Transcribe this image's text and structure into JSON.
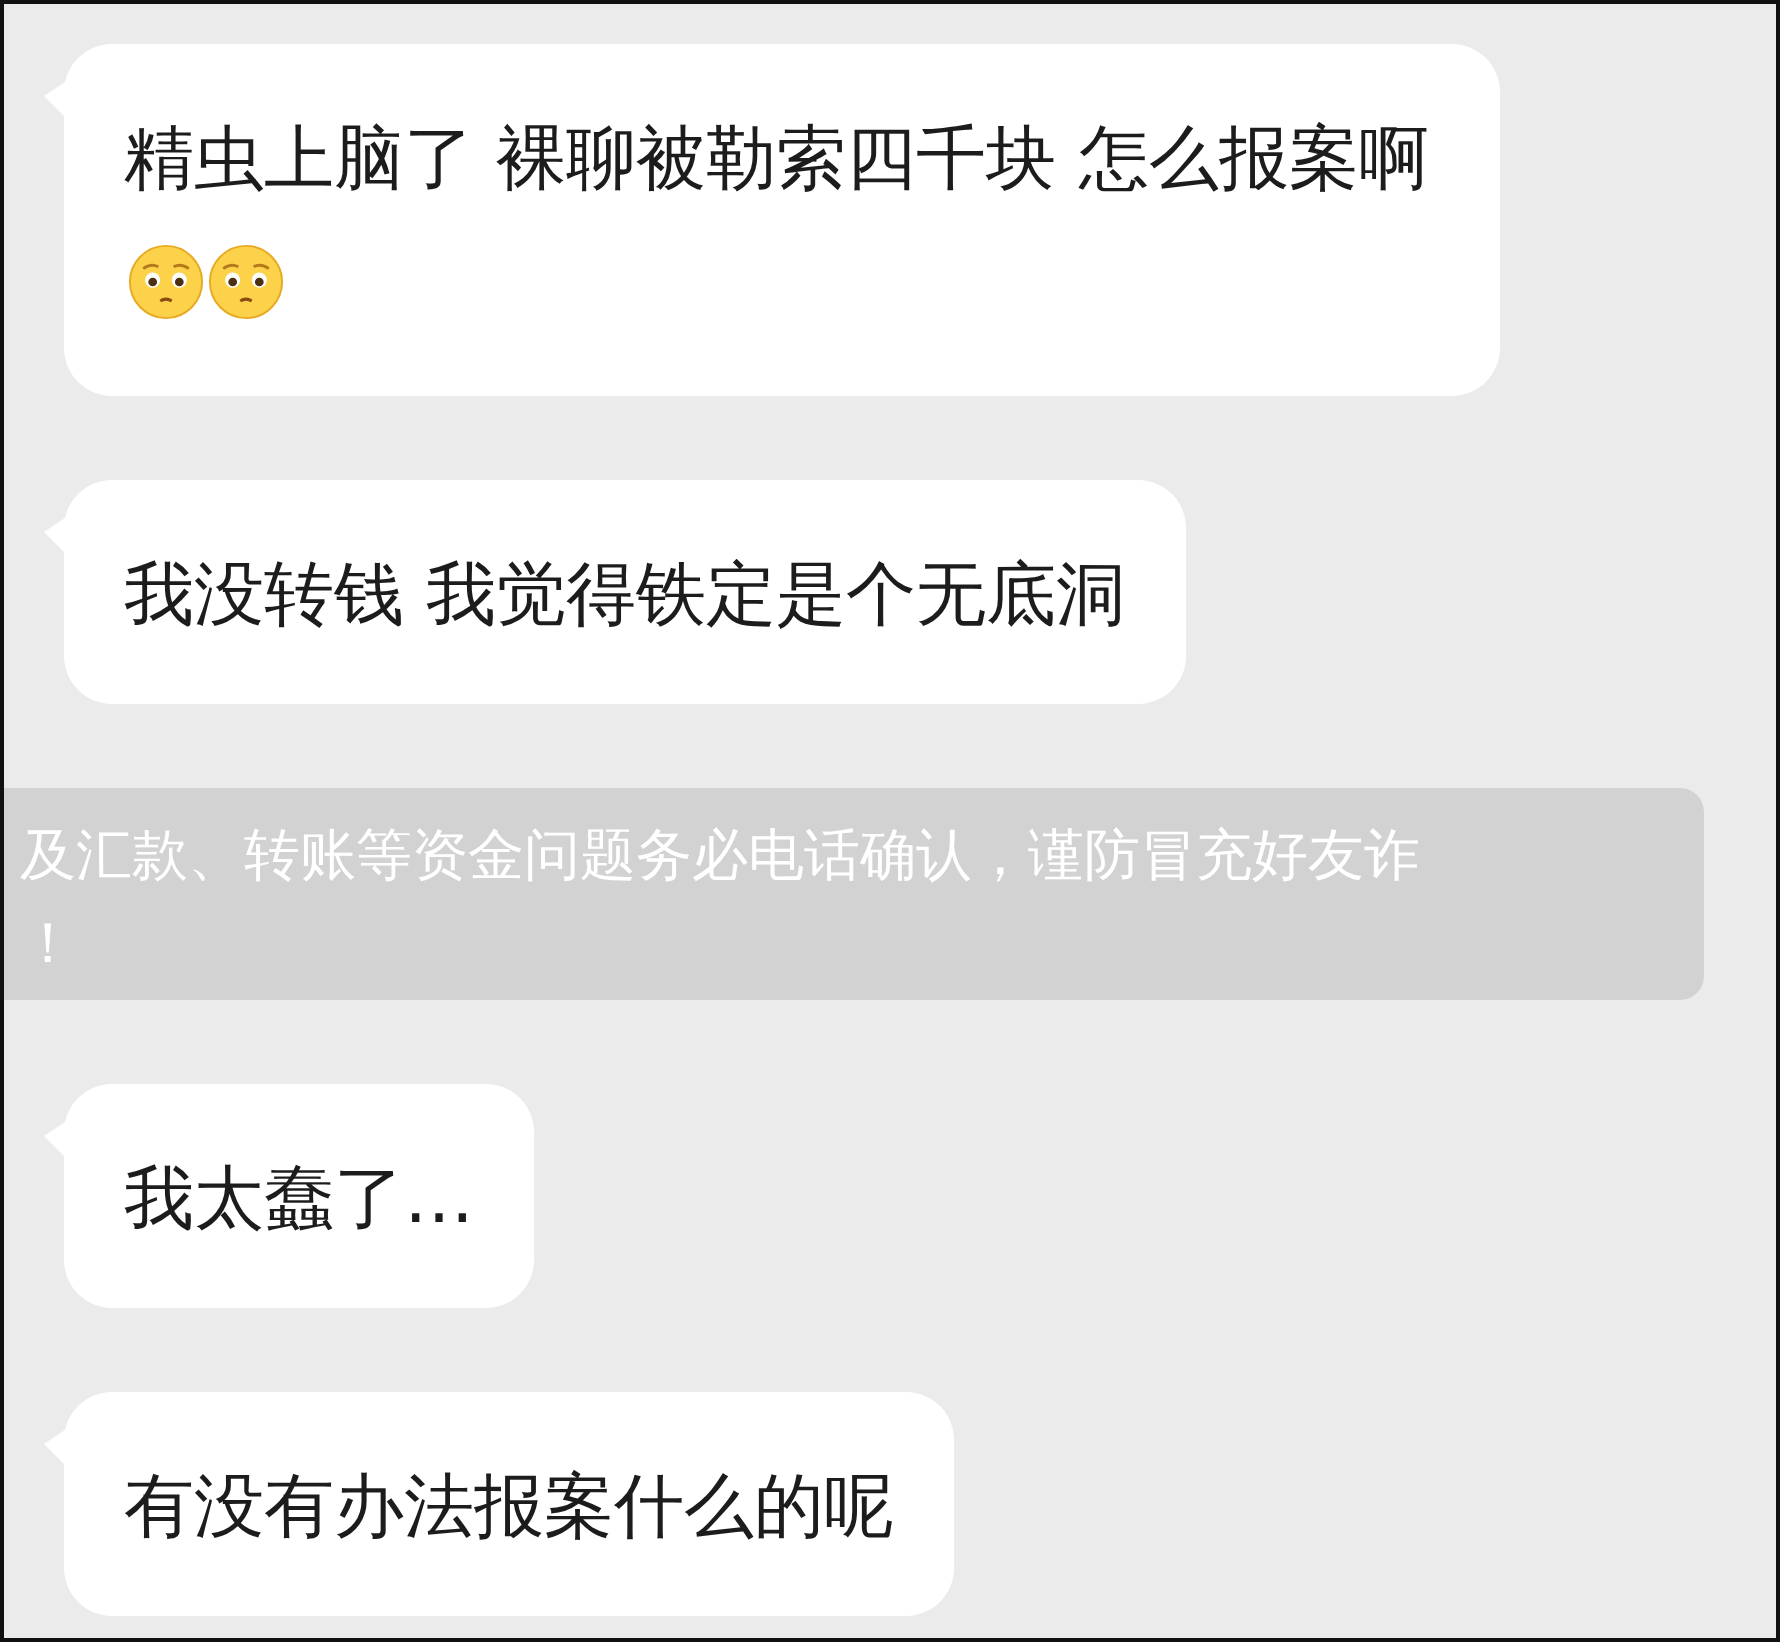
{
  "messages": [
    {
      "kind": "bubble",
      "parts": [
        {
          "kind": "text",
          "text": "精虫上脑了 裸聊被勒索四千块 怎么报案啊"
        },
        {
          "kind": "emoji"
        },
        {
          "kind": "emoji"
        }
      ]
    },
    {
      "kind": "bubble",
      "parts": [
        {
          "kind": "text",
          "text": "我没转钱 我觉得铁定是个无底洞"
        }
      ]
    },
    {
      "kind": "notice",
      "lines": [
        "及汇款、转账等资金问题务必电话确认，谨防冒充好友诈",
        "！"
      ]
    },
    {
      "kind": "bubble",
      "parts": [
        {
          "kind": "text",
          "text": "我太蠢了…"
        }
      ]
    },
    {
      "kind": "bubble",
      "parts": [
        {
          "kind": "text",
          "text": "有没有办法报案什么的呢"
        }
      ]
    }
  ]
}
